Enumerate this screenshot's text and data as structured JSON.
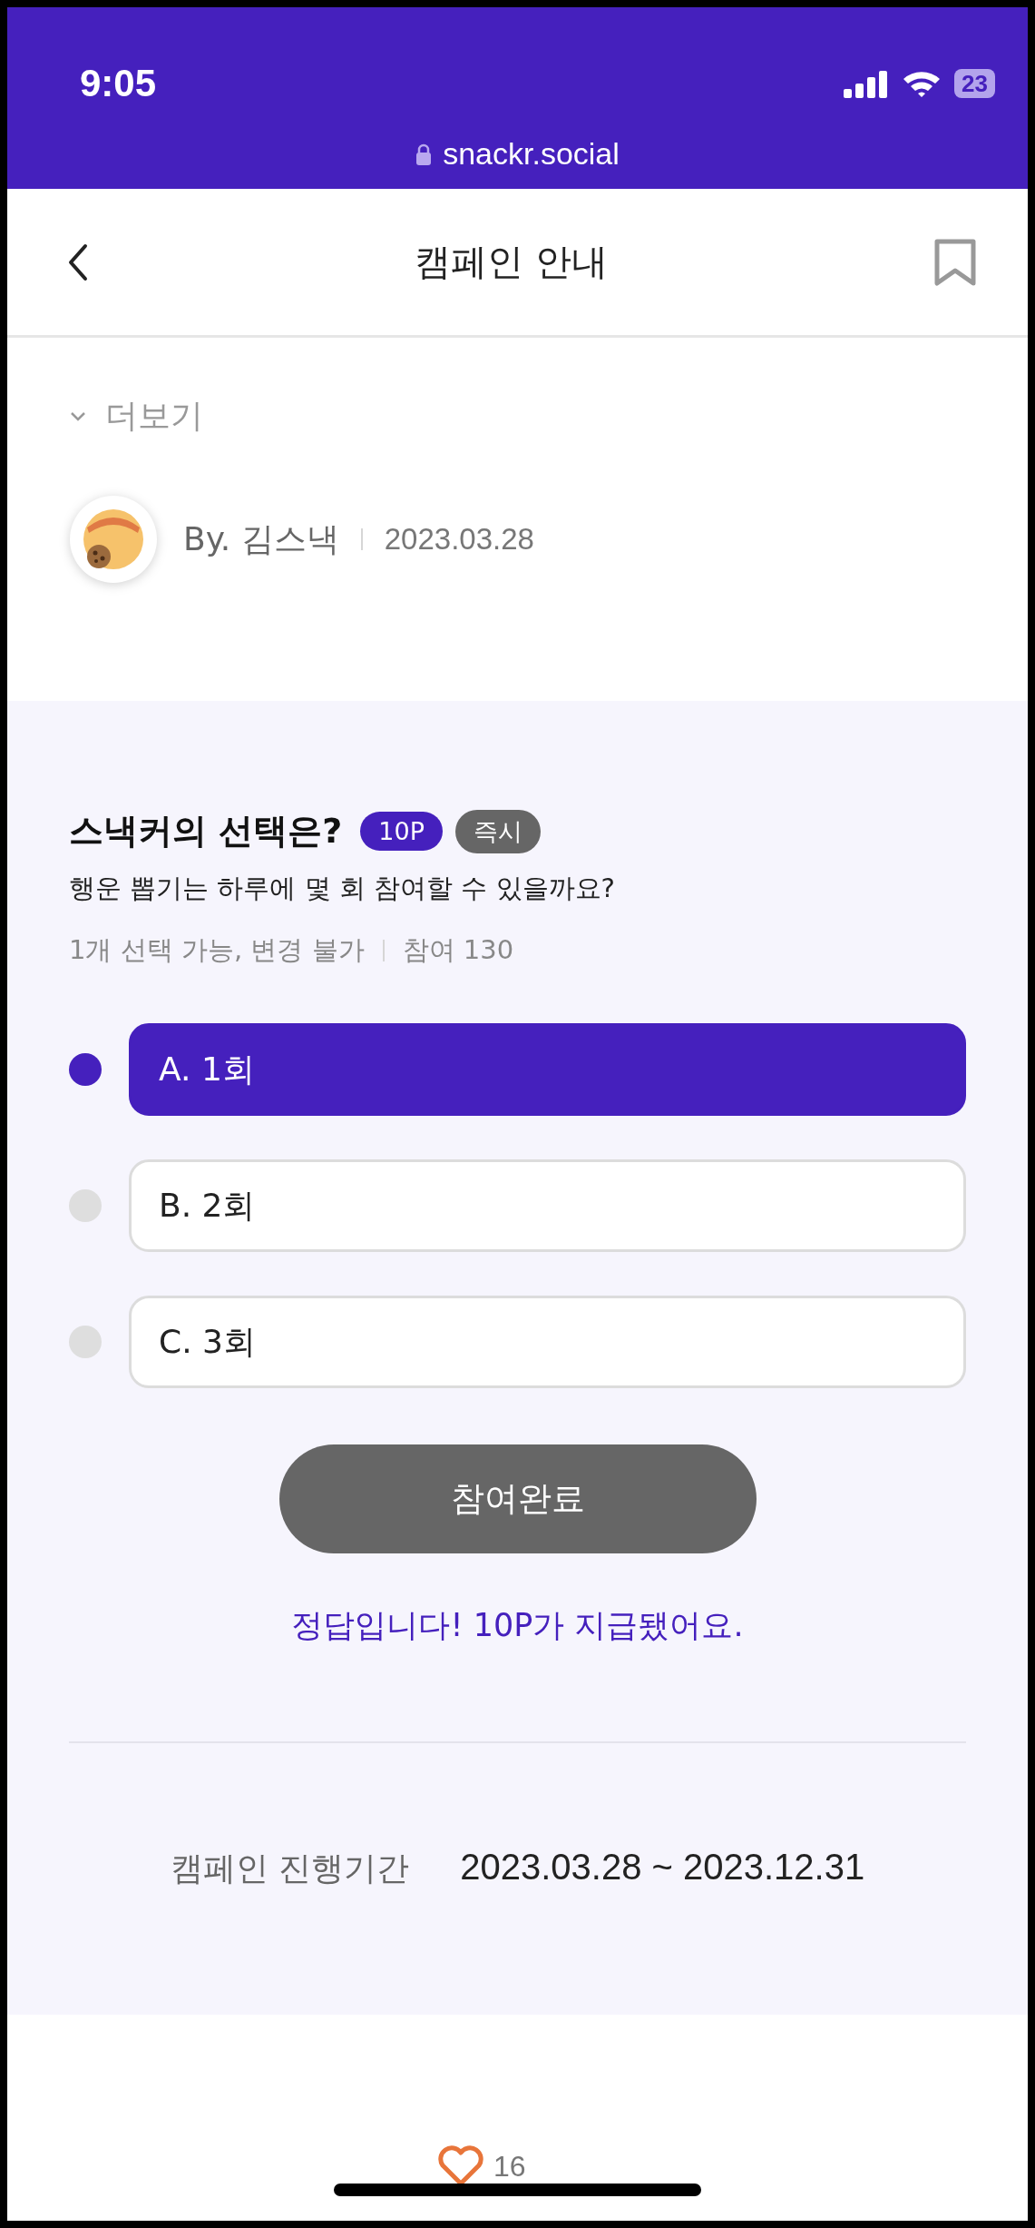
{
  "status_bar": {
    "time": "9:05",
    "battery": "23",
    "url": "snackr.social"
  },
  "nav": {
    "title": "캠페인 안내",
    "bookmarked": false
  },
  "more": {
    "label": "더보기"
  },
  "author": {
    "name": "By. 김스낵",
    "date": "2023.03.28"
  },
  "quiz": {
    "title": "스낵커의 선택은?",
    "badges": [
      {
        "label": "10P",
        "kind": "points"
      },
      {
        "label": "즉시",
        "kind": "instant"
      }
    ],
    "question": "행운 뽑기는 하루에 몇 회 참여할 수 있을까요?",
    "rule": "1개 선택 가능, 변경 불가",
    "participants": "참여 130",
    "options": [
      {
        "label": "A. 1회",
        "selected": true
      },
      {
        "label": "B. 2회",
        "selected": false
      },
      {
        "label": "C. 3회",
        "selected": false
      }
    ],
    "submit": {
      "label": "참여완료",
      "disabled": true
    },
    "result": "정답입니다! 10P가 지급됐어요.",
    "period_label": "캠페인 진행기간",
    "period": "2023.03.28 ~ 2023.12.31"
  },
  "likes": {
    "count": "16"
  }
}
